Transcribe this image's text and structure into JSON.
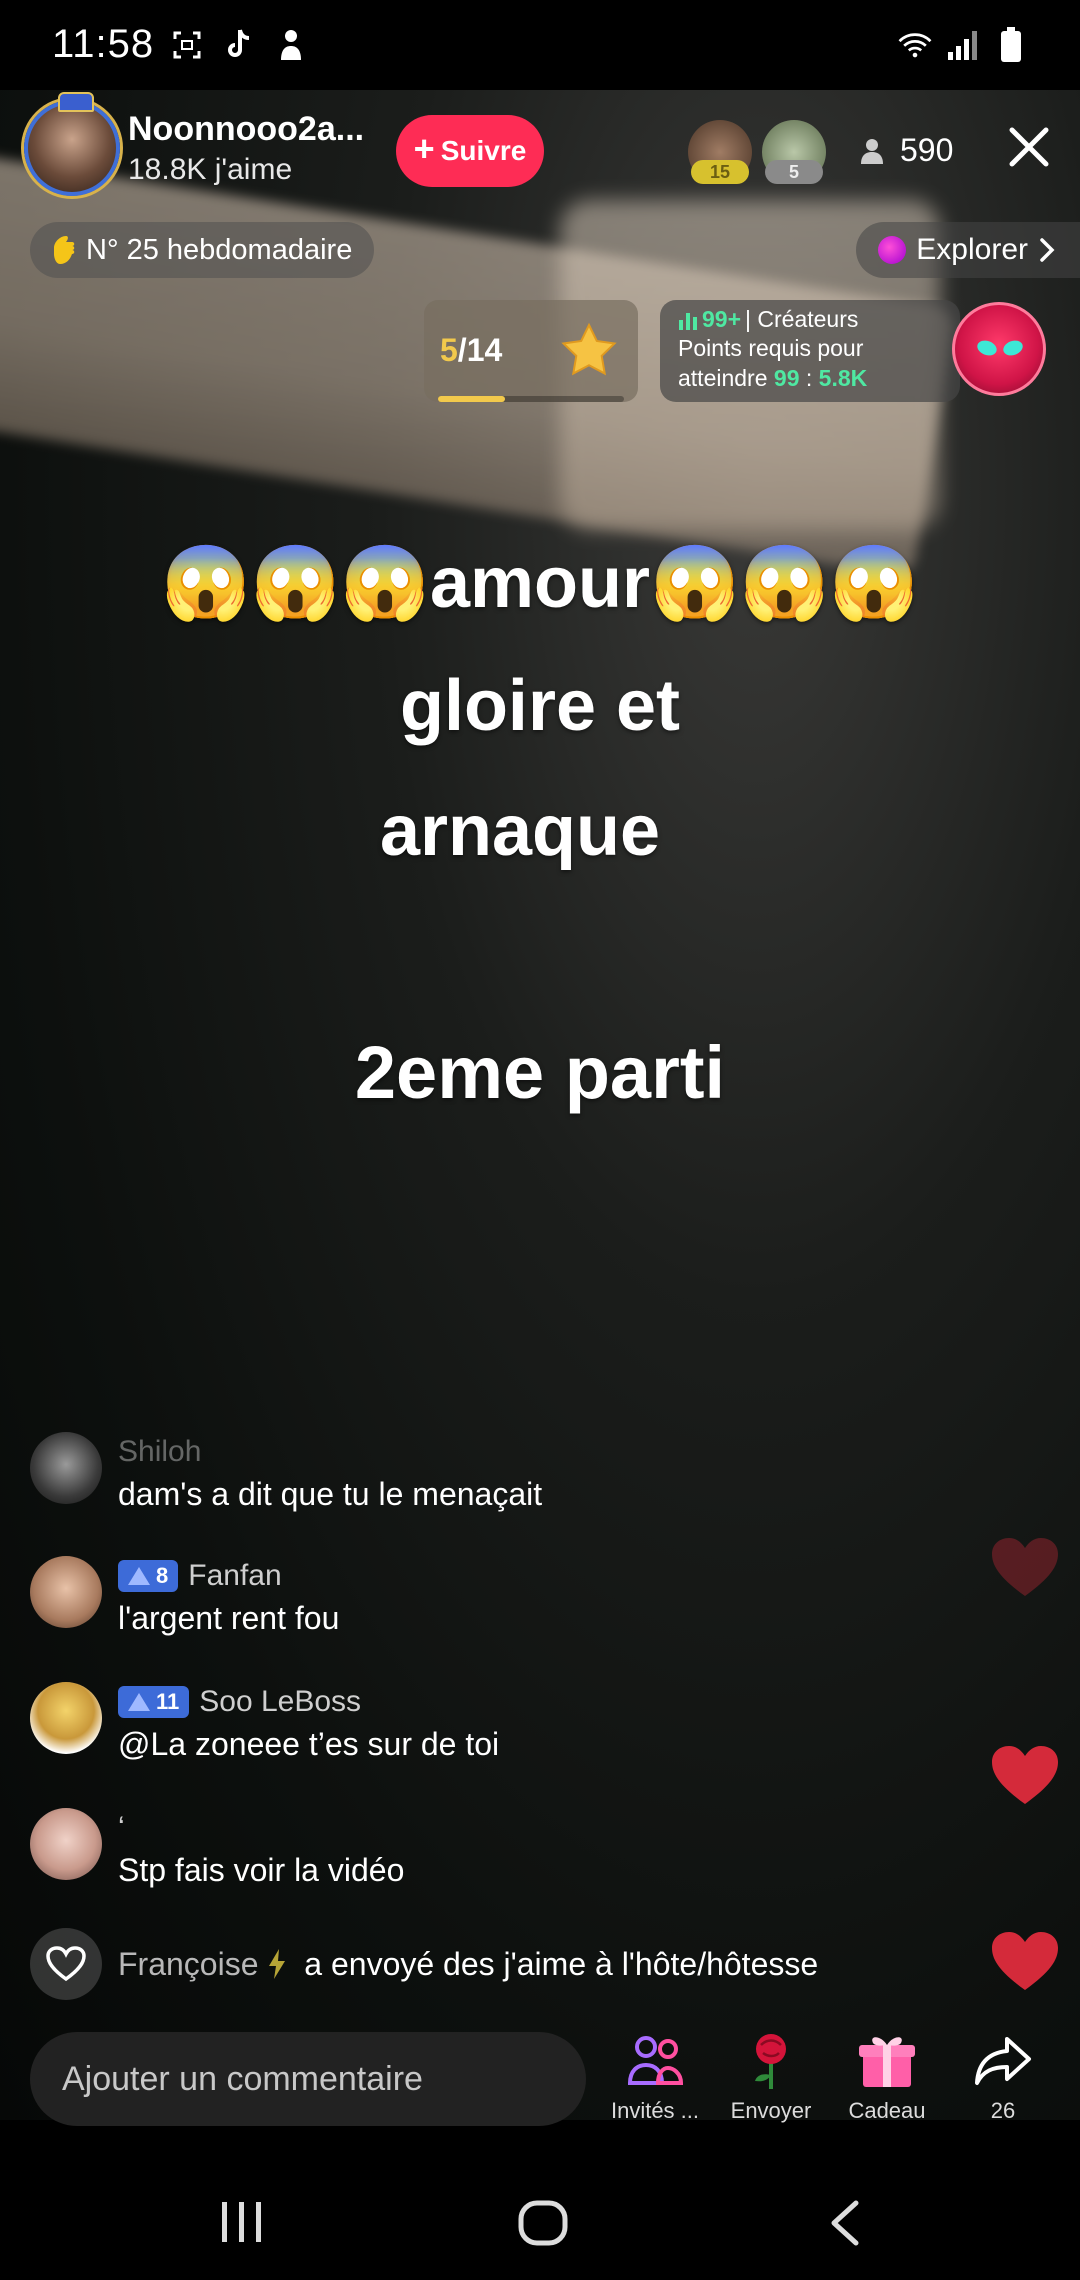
{
  "status_bar": {
    "time": "11:58",
    "left_icons": [
      "screenshot-icon",
      "tiktok-icon",
      "person-icon"
    ],
    "right_icons": [
      "wifi-icon",
      "signal-icon",
      "battery-icon"
    ]
  },
  "host": {
    "name": "Noonnooo2a...",
    "likes": "18.8K j'aime",
    "follow_label": "Suivre"
  },
  "viewers": {
    "badges": [
      "15",
      "5"
    ],
    "count": "590"
  },
  "weekly": {
    "label": "N° 25 hebdomadaire"
  },
  "explore": {
    "label": "Explorer"
  },
  "star_card": {
    "current": "5",
    "total": "/14",
    "progress": 0.36
  },
  "rank_card": {
    "rank": "99+",
    "category": "| Créateurs",
    "line1": "Points requis pour",
    "line2_prefix": "atteindre",
    "line2_target": "99",
    "line2_sep": ":",
    "line2_points": "5.8K"
  },
  "caption": {
    "line1_emoji_left": "😱😱😱",
    "line1_word": "amour",
    "line1_emoji_right": "😱😱😱",
    "line2": "gloire et",
    "line3": "arnaque",
    "line4": "2eme parti"
  },
  "comments": [
    {
      "user": "Shiloh",
      "level": "",
      "text": "dam's a dit que tu le menaçait"
    },
    {
      "user": "Fanfan",
      "level": "8",
      "text": "l'argent rent fou"
    },
    {
      "user": "Soo LeBoss",
      "level": "11",
      "text": "@La zoneee t’es sur de toi"
    },
    {
      "user": "‘",
      "level": "",
      "text": "Stp fais voir la vidéo"
    }
  ],
  "like_event": {
    "user": "Françoise",
    "text": "a envoyé des j'aime à l'hôte/hôtesse"
  },
  "bottom_bar": {
    "comment_placeholder": "Ajouter un commentaire",
    "invite_label": "Invités ...",
    "send_label": "Envoyer",
    "gift_label": "Cadeau",
    "share_count": "26"
  },
  "colors": {
    "accent": "#fe2c55",
    "level_badge": "#3d6bd8",
    "rank_green": "#4fe8a2",
    "star_gold": "#f2c94c",
    "heart_red": "#d42a3a"
  }
}
